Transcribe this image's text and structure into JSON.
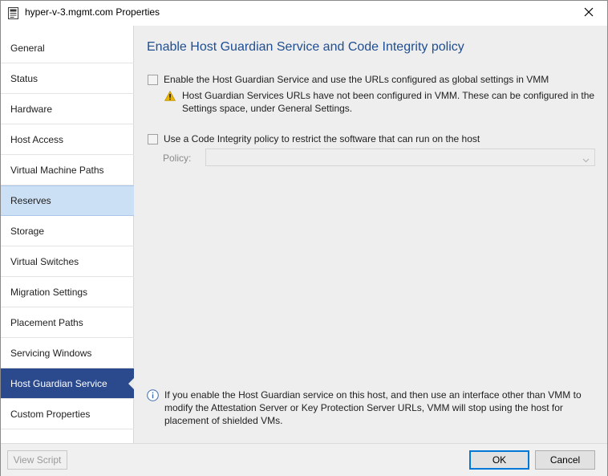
{
  "window": {
    "title": "hyper-v-3.mgmt.com Properties",
    "icon": "properties-window-icon",
    "close_icon": "close-icon"
  },
  "sidebar": {
    "items": [
      {
        "label": "General"
      },
      {
        "label": "Status"
      },
      {
        "label": "Hardware"
      },
      {
        "label": "Host Access"
      },
      {
        "label": "Virtual Machine Paths"
      },
      {
        "label": "Reserves"
      },
      {
        "label": "Storage"
      },
      {
        "label": "Virtual Switches"
      },
      {
        "label": "Migration Settings"
      },
      {
        "label": "Placement Paths"
      },
      {
        "label": "Servicing Windows"
      },
      {
        "label": "Host Guardian Service"
      },
      {
        "label": "Custom Properties"
      }
    ],
    "hovered": "Reserves",
    "selected": "Host Guardian Service"
  },
  "main": {
    "heading": "Enable Host Guardian Service and Code Integrity policy",
    "hgs_checkbox": {
      "label": "Enable the Host Guardian Service and use the URLs configured as global settings in VMM",
      "checked": false
    },
    "warning": {
      "icon": "warning-icon",
      "text": "Host Guardian Services URLs have not been configured in VMM. These can be configured in the Settings space, under General Settings."
    },
    "ci_checkbox": {
      "label": "Use a Code Integrity policy to restrict the software that can run on the host",
      "checked": false
    },
    "policy": {
      "label": "Policy:",
      "value": ""
    },
    "info": {
      "icon": "info-icon",
      "text": "If you enable the Host Guardian service on this host, and then use an interface other than VMM to modify the Attestation Server or Key Protection Server URLs, VMM will stop using the host for placement of shielded VMs."
    }
  },
  "footer": {
    "view_script": "View Script",
    "ok": "OK",
    "cancel": "Cancel"
  },
  "colors": {
    "heading": "#1f4e91",
    "selected_nav": "#2b4a8e",
    "hover_nav": "#cce0f5",
    "content_bg": "#eeeeee",
    "warning": "#e8b400"
  }
}
